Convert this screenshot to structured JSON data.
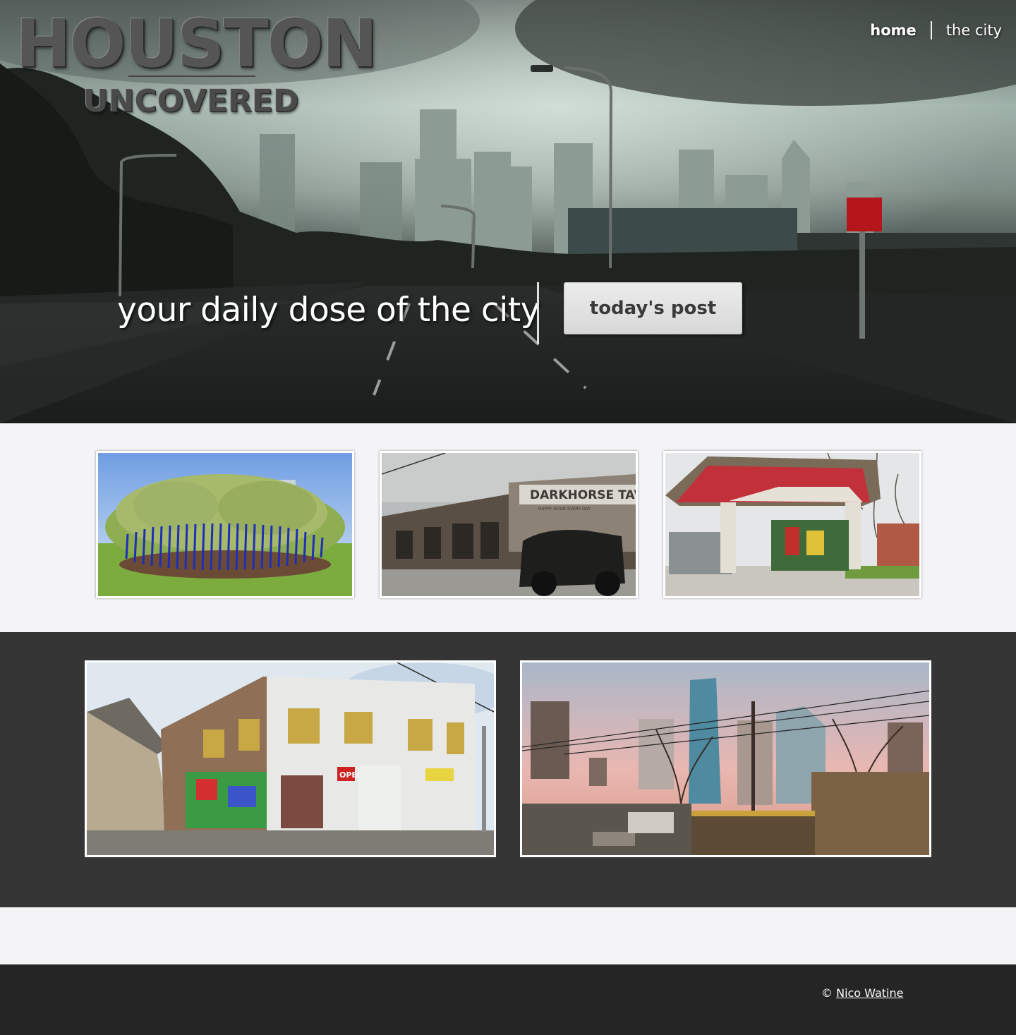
{
  "brand": {
    "title": "HOUSTON",
    "subtitle": "UNCOVERED"
  },
  "nav": {
    "items": [
      {
        "label": "home"
      },
      {
        "label": "the city"
      }
    ]
  },
  "hero": {
    "tagline": "your daily dose of the city",
    "cta_label": "today's post",
    "sign_color": "#b5161b"
  },
  "gallery": {
    "row1": [
      {
        "icon": "photo-blue-trees"
      },
      {
        "icon": "photo-darkhorse-tavern",
        "sign_text": "DARKHORSE TAVER",
        "sign_subtext": "HAPPY HOUR EVERY DAY"
      },
      {
        "icon": "photo-old-gas-station"
      }
    ],
    "row2": [
      {
        "icon": "photo-convenience-store",
        "sign_text": "OPEN"
      },
      {
        "icon": "photo-skyline-sunset"
      }
    ]
  },
  "footer": {
    "copyright_symbol": "©",
    "author": "Nico Watine"
  },
  "colors": {
    "dark_band": "#353535",
    "footer": "#252525",
    "page_bg": "#f4f4f6"
  }
}
